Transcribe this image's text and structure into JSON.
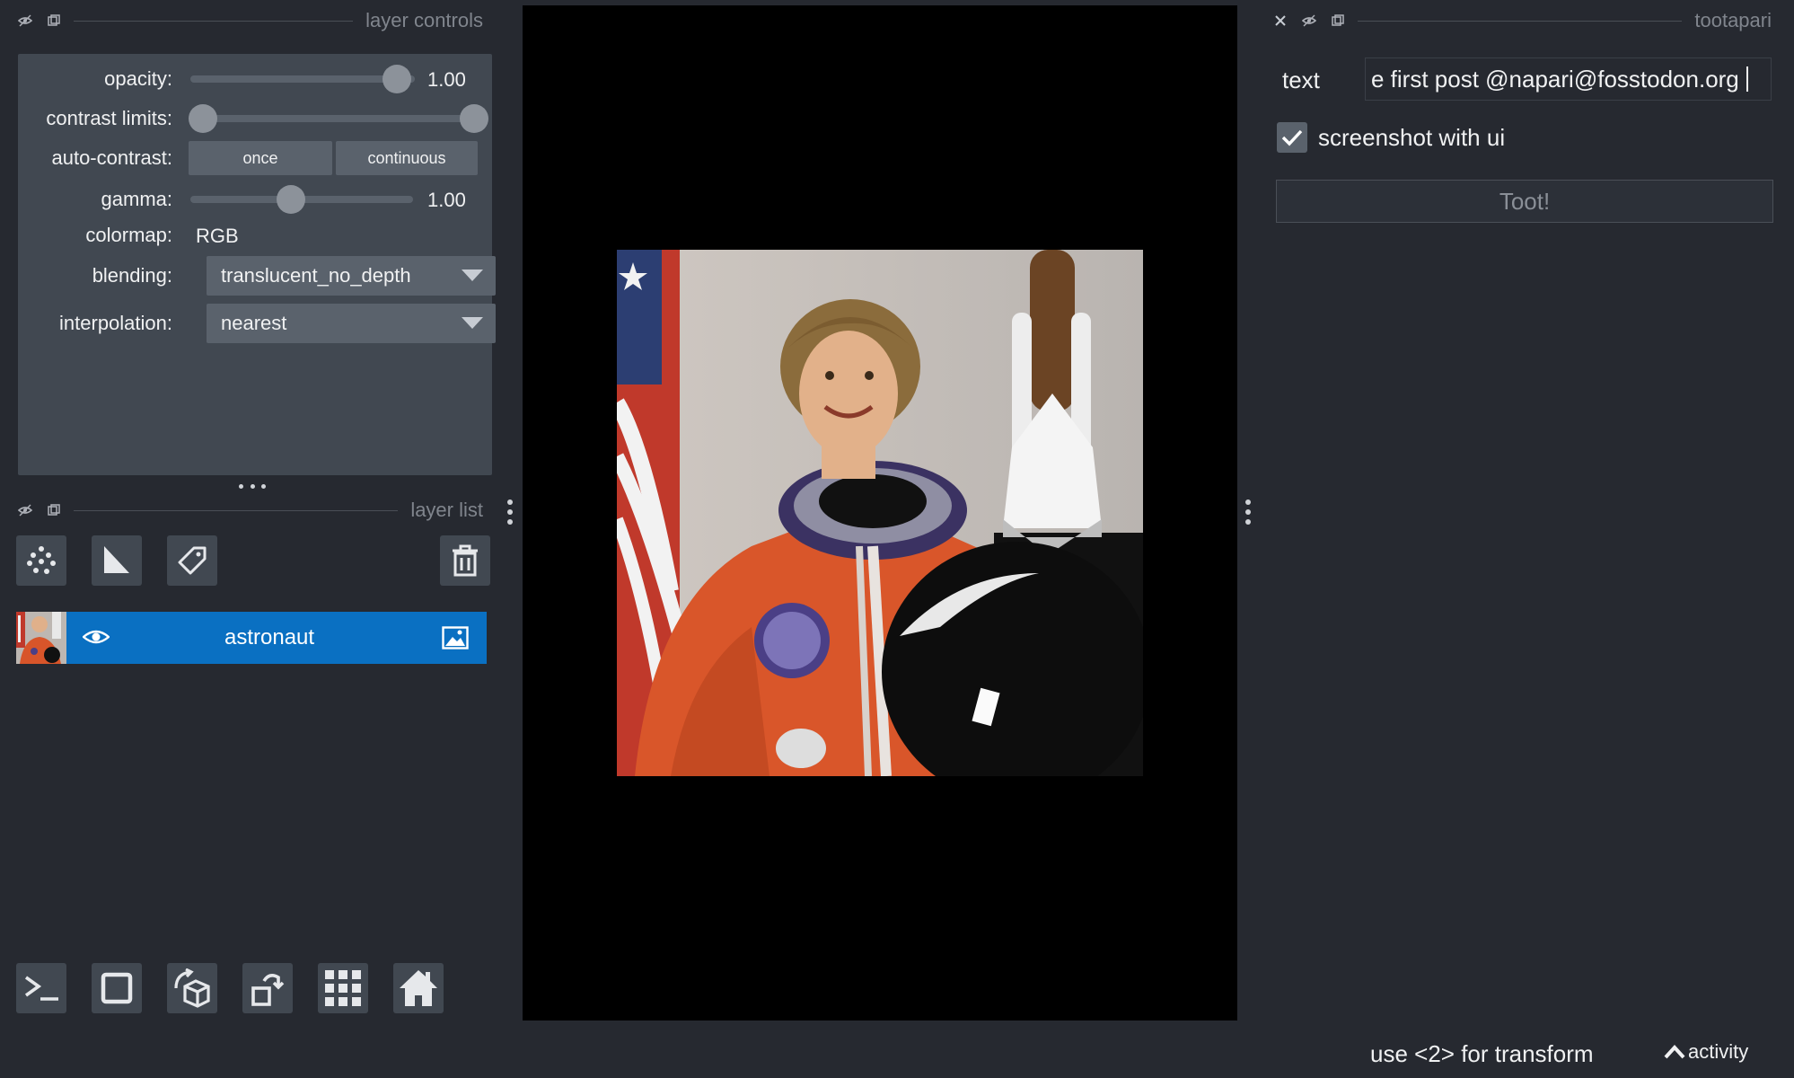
{
  "left_dock": {
    "controls_title": "layer controls",
    "layer_list_title": "layer list"
  },
  "layer_controls": {
    "opacity": {
      "label": "opacity:",
      "value": 1.0,
      "value_text": "1.00"
    },
    "contrast_limits": {
      "label": "contrast limits:",
      "range": [
        0.0,
        1.0
      ]
    },
    "auto_contrast": {
      "label": "auto-contrast:",
      "once_label": "once",
      "continuous_label": "continuous"
    },
    "gamma": {
      "label": "gamma:",
      "value": 0.5,
      "value_text": "1.00"
    },
    "colormap": {
      "label": "colormap:",
      "value": "RGB"
    },
    "blending": {
      "label": "blending:",
      "value": "translucent_no_depth"
    },
    "interpolation": {
      "label": "interpolation:",
      "value": "nearest"
    }
  },
  "layer_list": {
    "tools": [
      "points-icon",
      "shapes-icon",
      "labels-icon",
      "delete-icon"
    ],
    "layers": [
      {
        "name": "astronaut",
        "visible": true,
        "selected": true,
        "type_icon": "image-icon"
      }
    ]
  },
  "bottom_toolbar": [
    "console-icon",
    "ndisplay-2d-icon",
    "roll-dims-icon",
    "transpose-dims-icon",
    "grid-icon",
    "home-icon"
  ],
  "right_dock": {
    "title": "tootapari",
    "text_label": "text",
    "text_value": "e first post @napari@fosstodon.org",
    "screenshot_checkbox": {
      "label": "screenshot with ui",
      "checked": true
    },
    "toot_button": "Toot!"
  },
  "status_bar": {
    "message": "use <2> for transform",
    "activity_label": "activity"
  },
  "colors": {
    "background": "#262930",
    "panel": "#414851",
    "accent": "#0a70c2"
  }
}
